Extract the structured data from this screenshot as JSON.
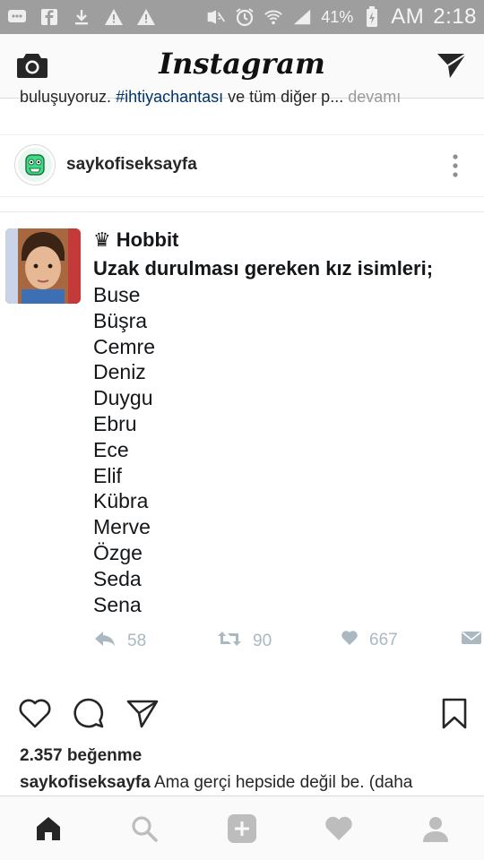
{
  "status_bar": {
    "battery": "41%",
    "am_pm": "AM",
    "time": "2:18"
  },
  "app": {
    "title": "Instagram"
  },
  "feed": {
    "prev_caption": {
      "text": "buluşuyoruz. ",
      "hashtag": "#ihtiyachantası",
      "rest": " ve tüm diğer p...",
      "more": " devamı"
    }
  },
  "post": {
    "username": "saykofiseksayfa",
    "tweet": {
      "author_icon": "♛",
      "author": "Hobbit",
      "heading": "Uzak durulması gereken kız isimleri;",
      "names": [
        "Buse",
        "Büşra",
        "Cemre",
        "Deniz",
        "Duygu",
        "Ebru",
        "Ece",
        "Elif",
        "Kübra",
        "Merve",
        "Özge",
        "Seda",
        "Sena"
      ],
      "replies": "58",
      "retweets": "90",
      "likes": "667"
    },
    "likes_text": "2.357 beğenme",
    "caption_user": "saykofiseksayfa",
    "caption_text": " Ama gerçi hepside değil be. (daha"
  },
  "colors": {
    "status_bar_bg": "#9e9e9e",
    "app_bar_bg": "#fafafa",
    "hashtag": "#003569",
    "tweet_action": "#aab8c2",
    "avatar_green": "#3ddc84"
  },
  "icons": {
    "camera": "camera-icon",
    "direct": "paper-plane-icon",
    "like": "heart-icon",
    "comment": "comment-icon",
    "share": "send-icon",
    "save": "bookmark-icon"
  }
}
